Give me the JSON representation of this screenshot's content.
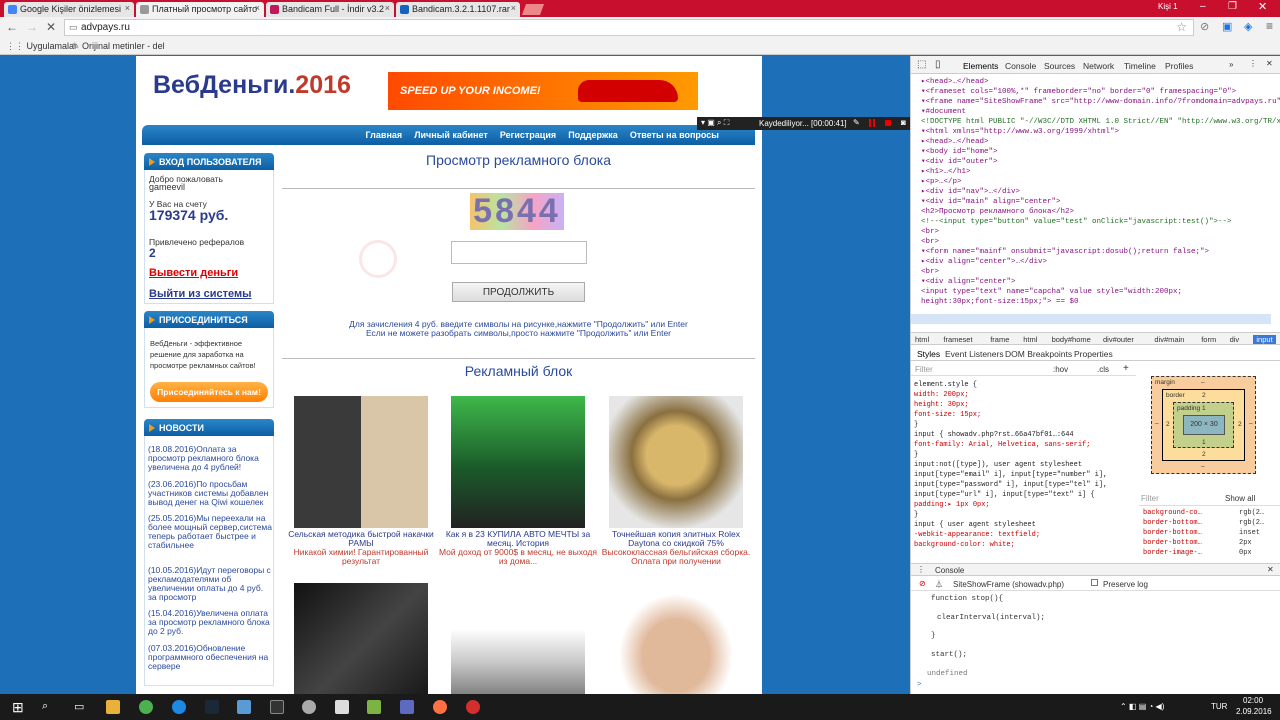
{
  "browser": {
    "tabs": [
      {
        "label": "Google Kişiler önizlemesi",
        "close": "×"
      },
      {
        "label": "Платный просмотр сайто",
        "close": "×"
      },
      {
        "label": "Bandicam Full - İndir v3.2",
        "close": "×"
      },
      {
        "label": "Bandicam.3.2.1.1107.rar",
        "close": "×"
      }
    ],
    "profile": "Kişi 1",
    "url": "advpays.ru",
    "bookmarks": [
      {
        "label": "Uygulamalar"
      },
      {
        "label": "Orijinal metinler - del"
      }
    ]
  },
  "site": {
    "logo_main": "ВебДеньги.",
    "logo_year": "2016",
    "banner": "SPEED UP YOUR INCOME!",
    "nav": [
      "Главная",
      "Личный кабинет",
      "Регистрация",
      "Поддержка",
      "Ответы на вопросы"
    ],
    "login": {
      "header": "ВХОД ПОЛЬЗОВАТЕЛЯ",
      "welcome": "Добро пожаловать",
      "user": "gameevil",
      "balance_label": "У Вас на счету",
      "balance": "179374 руб.",
      "ref_label": "Привлечено рефералов",
      "ref_count": "2",
      "withdraw": "Вывести деньги",
      "logout": "Выйти из системы"
    },
    "join": {
      "header": "ПРИСОЕДИНИТЬСЯ",
      "text": "ВебДеньги - эффективное решение для заработка на просмотре рекламных сайтов!",
      "button": "Присоединяйтесь к нам!"
    },
    "news": {
      "header": "НОВОСТИ",
      "items": [
        "(18.08.2016)Оплата за просмотр рекламного блока увеличена до 4 рублей!",
        "(23.06.2016)По просьбам участников системы добавлен вывод денег на Qiwi кошелек",
        "(25.05.2016)Мы переехали на более мощный сервер,система теперь работает быстрее и стабильнее",
        "(10.05.2016)Идут переговоры с рекламодателями об увеличении оплаты до 4 руб. за просмотр",
        "(15.04.2016)Увеличена оплата за просмотр рекламного блока до 2 руб.",
        "(07.03.2016)Обновление программного обеспечения на сервере"
      ]
    },
    "main": {
      "title": "Просмотр рекламного блока",
      "captcha": "5844",
      "captcha_value": "",
      "continue_button": "ПРОДОЛЖИТЬ",
      "hint1": "Для зачисления 4 руб. введите символы на рисунке,нажмите \"Продолжить\" или Enter",
      "hint2": "Если не можете разобрать символы,просто нажмите \"Продолжить\" или Enter",
      "ads_title": "Рекламный блок",
      "ads": [
        {
          "title": "Сельская методика быстрой накачки РАМЫ",
          "desc": "Никакой химии! Гарантированный результат"
        },
        {
          "title": "Как я в 23 КУПИЛА АВТО МЕЧТЫ за месяц. История",
          "desc": "Мой доход от 9000$ в месяц, не выходя из дома..."
        },
        {
          "title": "Точнейшая копия элитных Rolex Daytona со скидкой 75%",
          "desc": "Высококлассная бельгийская сборка. Оплата при получении"
        }
      ]
    }
  },
  "recorder": {
    "label": "Kaydediliyor... [00:00:41]"
  },
  "devtools": {
    "tabs": [
      "Elements",
      "Console",
      "Sources",
      "Network",
      "Timeline",
      "Profiles"
    ],
    "dom_lines": [
      "▸<head>…</head>",
      "▾<frameset cols=\"100%,*\" frameborder=\"no\" border=\"0\" framespacing=\"0\">",
      "  ▾<frame name=\"SiteShowFrame\" src=\"http://www-domain.info/?fromdomain=advpays.ru\">",
      "    ▾#document",
      "      <!DOCTYPE html PUBLIC \"-//W3C//DTD XHTML 1.0 Strict//EN\" \"http://www.w3.org/TR/xhtml1/DTD/xhtml1-strict.dtd\">",
      "      ▾<html xmlns=\"http://www.w3.org/1999/xhtml\">",
      "        ▸<head>…</head>",
      "        ▾<body id=\"home\">",
      "          ▾<div id=\"outer\">",
      "            ▸<h1>…</h1>",
      "            ▸<p>…</p>",
      "            ▸<div id=\"nav\">…</div>",
      "            ▾<div id=\"main\" align=\"center\">",
      "               <h2>Просмотр рекламного блока</h2>",
      "               <!--<input type=\"button\" value=\"test\" onClick=\"javascript:test()\">-->",
      "               <br>",
      "               <br>",
      "              ▾<form name=\"mainf\" onsubmit=\"javascript:dosub();return false;\">",
      "                ▸<div align=\"center\">…</div>",
      "                 <br>",
      "                ▾<div align=\"center\">",
      "                   <input type=\"text\" name=\"capcha\" value style=\"width:200px;",
      "                   height:30px;font-size:15px;\"> == $0"
    ],
    "breadcrumbs": [
      "html",
      "frameset",
      "frame",
      "html",
      "body#home",
      "div#outer",
      "div#main",
      "form",
      "div",
      "input"
    ],
    "subtabs": [
      "Styles",
      "Event Listeners",
      "DOM Breakpoints",
      "Properties"
    ],
    "filter_placeholder": "Filter",
    "filter_hov": ":hov",
    "filter_cls": ".cls",
    "styles": [
      "element.style {",
      "  width: 200px;",
      "  height: 30px;",
      "  font-size: 15px;",
      "}",
      "input {                    showadv.php?rst…66a47bf01…:644",
      "  font-family: Arial, Helvetica, sans-serif;",
      "}",
      "input:not([type]),          user agent stylesheet",
      "input[type=\"email\" i], input[type=\"number\" i],",
      "input[type=\"password\" i], input[type=\"tel\" i],",
      "input[type=\"url\" i], input[type=\"text\" i] {",
      "  padding:▸ 1px 0px;",
      "}",
      "input {                     user agent stylesheet",
      "  -webkit-appearance: textfield;",
      "  background-color: white;"
    ],
    "boxmodel": {
      "margin": "margin",
      "border": "border",
      "padding": "padding",
      "size": "200 × 30",
      "dash": "–",
      "two": "2",
      "one": "1"
    },
    "computed_filter": "Filter",
    "show_all": "Show all",
    "computed": [
      {
        "name": "background-co…",
        "value": "rgb(2…"
      },
      {
        "name": "border-bottom…",
        "value": "rgb(2…"
      },
      {
        "name": "border-bottom…",
        "value": "inset"
      },
      {
        "name": "border-bottom…",
        "value": "2px"
      },
      {
        "name": "border-image-…",
        "value": "0px"
      }
    ],
    "console": {
      "tab": "Console",
      "context": "SiteShowFrame (showadv.php)",
      "preserve": "Preserve log",
      "lines": [
        "function stop(){",
        "",
        "clearInterval(interval);",
        "",
        "}",
        "",
        "start();"
      ],
      "result": "undefined",
      "prompt": ">"
    }
  },
  "taskbar": {
    "lang": "TUR",
    "time": "02:00",
    "date": "2.09.2016"
  }
}
